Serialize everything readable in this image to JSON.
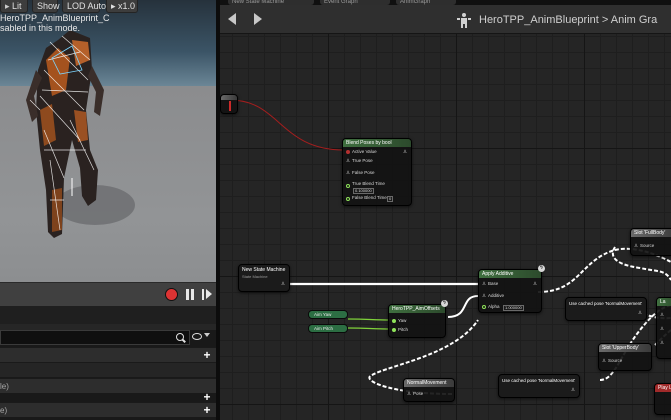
{
  "viewport": {
    "toolbar": {
      "lit_label": "Lit",
      "show_label": "Show",
      "lod_label": "LOD Auto",
      "speed_label": "x1.0"
    },
    "preview_title": "HeroTPP_AnimBlueprint_C",
    "preview_subtitle": "sabled in this mode."
  },
  "details_panel": {
    "row3_text": "le)",
    "row4_text": "e)"
  },
  "graph": {
    "tabs": [
      "New State Machine",
      "Event Graph",
      "AnimGraph"
    ],
    "breadcrumb": "HeroTPP_AnimBlueprint > Anim Gra",
    "nodes": {
      "blend_poses": {
        "title": "Blend Poses by bool",
        "active_value": "Active Value",
        "true_pose": "True Pose",
        "false_pose": "False Pose",
        "true_blend_time": "True Blend Time",
        "true_blend_value": "0.100000",
        "false_blend_time": "False Blend Time",
        "false_blend_value": "0"
      },
      "state_machine": {
        "title": "New State Machine",
        "subtitle": "State Machine"
      },
      "apply_additive": {
        "title": "Apply Additive",
        "base": "Base",
        "additive": "Additive",
        "alpha": "Alpha",
        "alpha_value": "1.000000"
      },
      "aim_offset": {
        "title": "HeroTPP_AimOffsets",
        "yaw": "Yaw",
        "pitch": "Pitch"
      },
      "aim_yaw": "Aim Yaw",
      "aim_pitch": "Aim Pitch",
      "normal_movement": {
        "title": "NormalMovement",
        "pose": "Pose"
      },
      "use_cached_1": "Use cached pose 'NormalMovement'",
      "use_cached_2": "Use cached pose 'NormalMovement'",
      "slot_upper": {
        "title": "Slot 'UpperBody'",
        "source": "Source"
      },
      "slot_full": {
        "title": "Slot 'FullBody'",
        "source": "Source"
      },
      "layered": "La",
      "play": "Play L"
    }
  }
}
